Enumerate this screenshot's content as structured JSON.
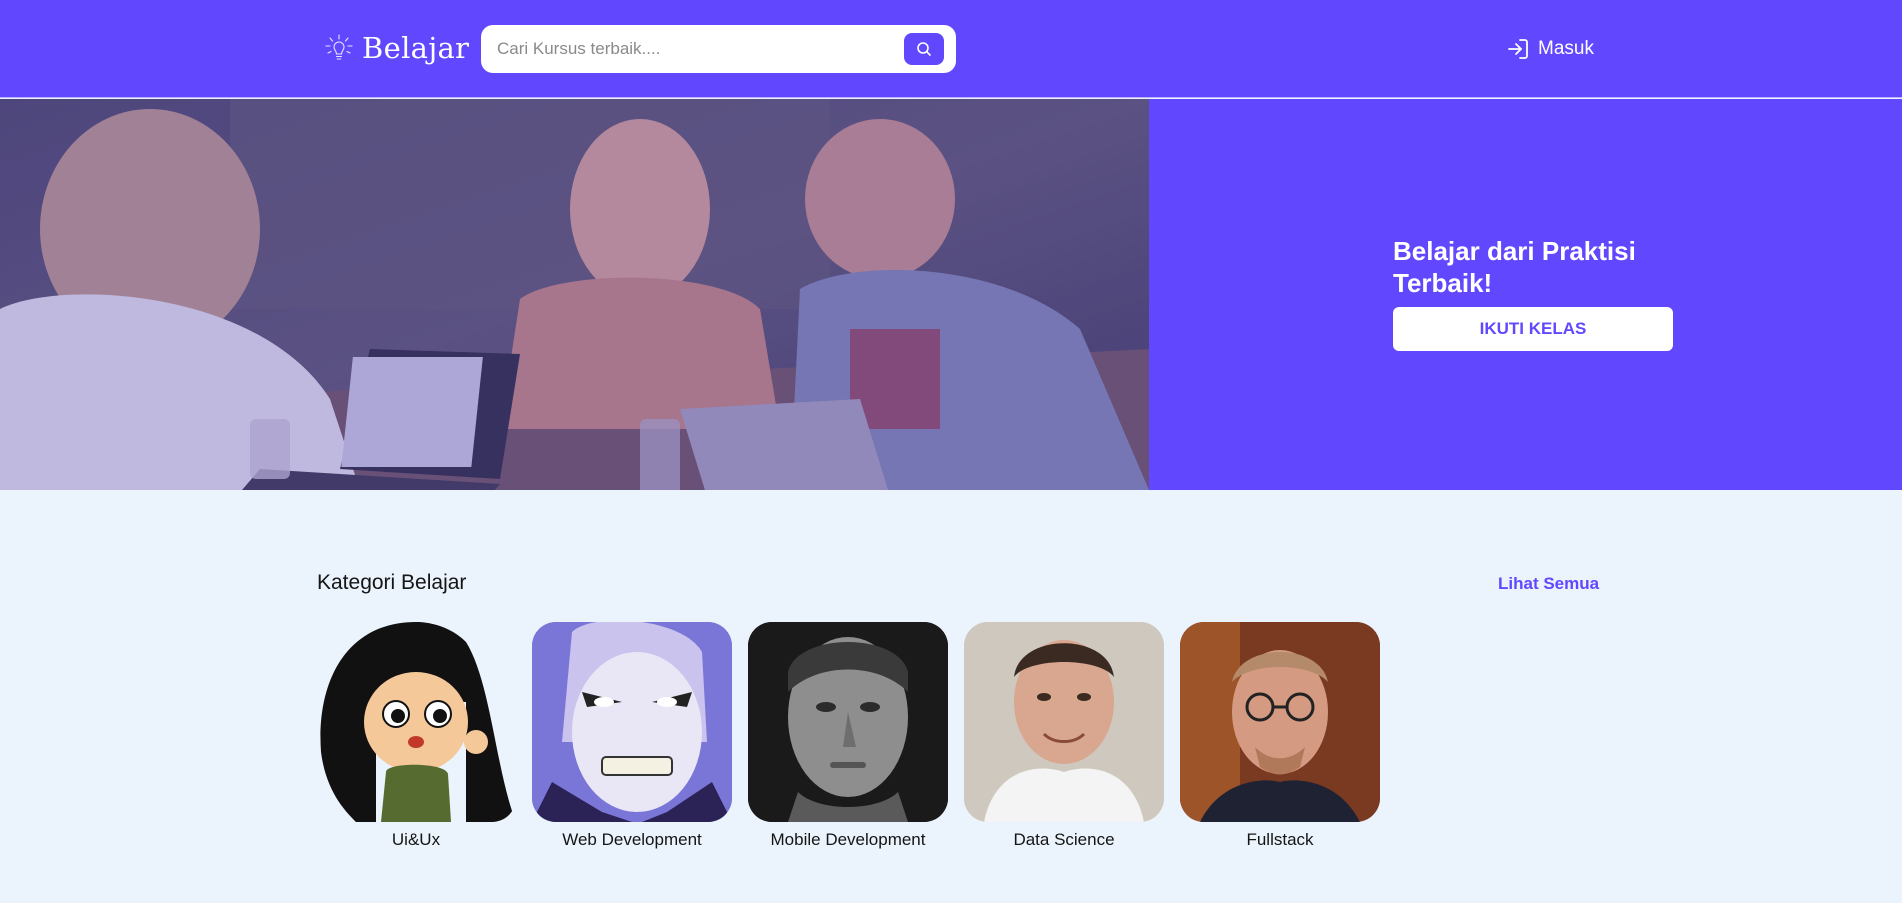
{
  "colors": {
    "primary": "#6148FF",
    "page_background": "#EBF3FC",
    "text_dark": "#151515",
    "white": "#FFFFFF"
  },
  "header": {
    "logo_text": "Belajar",
    "logo_icon": "lightbulb-icon",
    "search": {
      "placeholder": "Cari Kursus terbaik....",
      "value": "",
      "button_icon": "search-icon"
    },
    "login": {
      "label": "Masuk",
      "icon": "login-icon"
    }
  },
  "hero": {
    "title": "Belajar dari Praktisi Terbaik!",
    "button_label": "IKUTI KELAS"
  },
  "categories": {
    "title": "Kategori Belajar",
    "see_all_label": "Lihat Semua",
    "items": [
      {
        "label": "Ui&Ux"
      },
      {
        "label": "Web Development"
      },
      {
        "label": "Mobile Development"
      },
      {
        "label": "Data Science"
      },
      {
        "label": "Fullstack"
      }
    ]
  }
}
